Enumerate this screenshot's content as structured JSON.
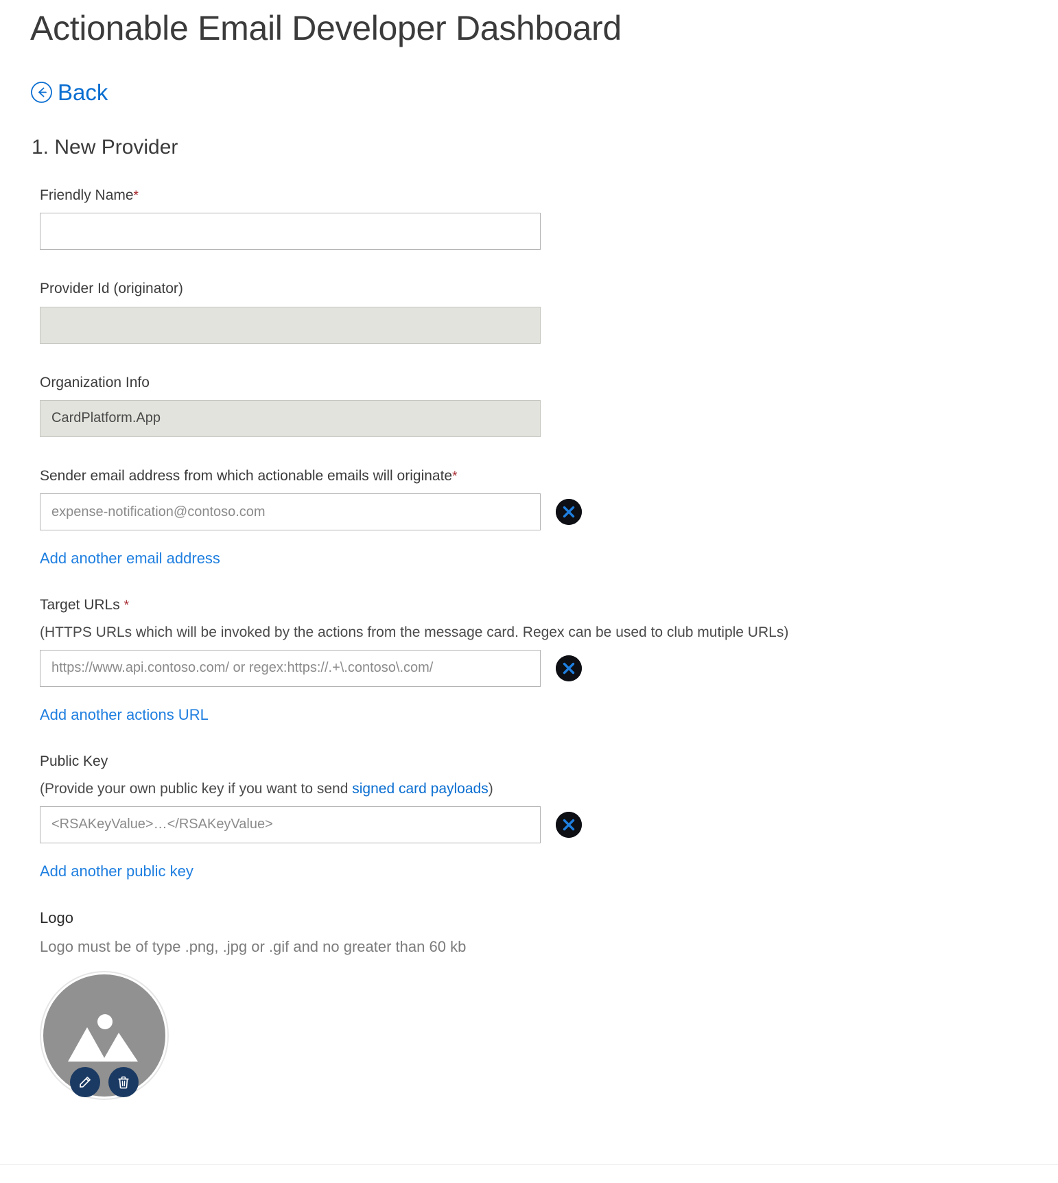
{
  "header": {
    "title": "Actionable Email Developer Dashboard",
    "back_label": "Back",
    "back_icon": "back-circle-arrow-icon",
    "step_title": "1. New Provider"
  },
  "form": {
    "friendly_name": {
      "label": "Friendly Name",
      "required_marker": "*",
      "value": "",
      "placeholder": ""
    },
    "provider_id": {
      "label": "Provider Id (originator)",
      "value": "",
      "placeholder": "",
      "readonly": true
    },
    "organization_info": {
      "label": "Organization Info",
      "value": "CardPlatform.App",
      "placeholder": "",
      "readonly": true
    },
    "sender_email": {
      "label": "Sender email address from which actionable emails will originate",
      "required_marker": "*",
      "value": "",
      "placeholder": "expense-notification@contoso.com",
      "remove_icon": "remove-x-circle-icon",
      "add_link": "Add another email address"
    },
    "target_urls": {
      "label": "Target URLs",
      "required_marker": "*",
      "note": "(HTTPS URLs which will be invoked by the actions from the message card. Regex can be used to club mutiple URLs)",
      "value": "",
      "placeholder": "https://www.api.contoso.com/ or regex:https://.+\\.contoso\\.com/",
      "remove_icon": "remove-x-circle-icon",
      "add_link": "Add another actions URL"
    },
    "public_key": {
      "label": "Public Key",
      "note_before": "(Provide your own public key if you want to send ",
      "note_link": "signed card payloads",
      "note_after": ")",
      "value": "",
      "placeholder": "<RSAKeyValue>…</RSAKeyValue>",
      "remove_icon": "remove-x-circle-icon",
      "add_link": "Add another public key"
    },
    "logo": {
      "label": "Logo",
      "note": "Logo must be of type .png, .jpg or .gif and no greater than 60 kb",
      "placeholder_icon": "image-placeholder-icon",
      "edit_icon": "pencil-edit-icon",
      "delete_icon": "trash-delete-icon"
    }
  },
  "colors": {
    "link": "#1f7fe0",
    "back_link": "#0a6ed1",
    "required": "#a4262c",
    "readonly_field_bg": "#e3e3dd",
    "avatar_bg": "#919191",
    "avatar_button": "#1b3a63",
    "remove_button": "#0d0f14",
    "text": "#3b3b3b"
  }
}
